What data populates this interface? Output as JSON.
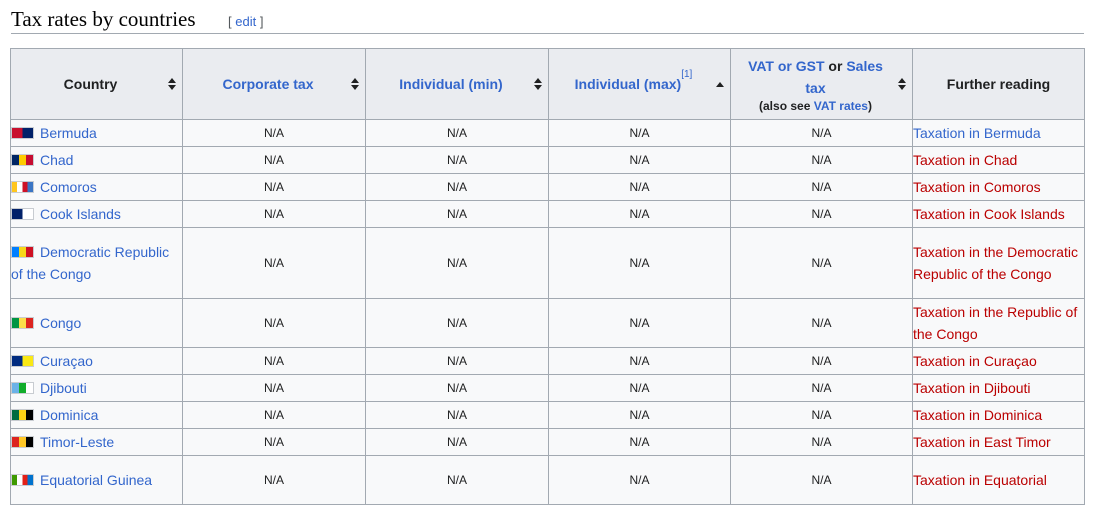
{
  "section": {
    "title": "Tax rates by countries",
    "edit_open": "[ ",
    "edit_label": "edit",
    "edit_close": " ]"
  },
  "table": {
    "headers": {
      "country": "Country",
      "corporate": "Corporate tax",
      "individual_min": "Individual (min)",
      "individual_max": "Individual (max)",
      "individual_max_ref": "[1]",
      "vat_part1": "VAT or GST",
      "vat_or": " or ",
      "vat_part2": "Sales",
      "vat_part3": "tax",
      "vat_note_prefix": "(also see ",
      "vat_note_link": "VAT rates",
      "vat_note_suffix": ")",
      "further": "Further reading"
    },
    "rows": [
      {
        "country": "Bermuda",
        "flag_colors": [
          "#c8102e",
          "#012169"
        ],
        "corporate": "N/A",
        "individual_min": "N/A",
        "individual_max": "N/A",
        "vat": "N/A",
        "further": "Taxation in Bermuda",
        "further_exists": true
      },
      {
        "country": "Chad",
        "flag_colors": [
          "#002664",
          "#fecb00",
          "#c60c30"
        ],
        "corporate": "N/A",
        "individual_min": "N/A",
        "individual_max": "N/A",
        "vat": "N/A",
        "further": "Taxation in Chad",
        "further_exists": false
      },
      {
        "country": "Comoros",
        "flag_colors": [
          "#ffc61e",
          "#ffffff",
          "#ce1126",
          "#3a75c4"
        ],
        "corporate": "N/A",
        "individual_min": "N/A",
        "individual_max": "N/A",
        "vat": "N/A",
        "further": "Taxation in Comoros",
        "further_exists": false
      },
      {
        "country": "Cook Islands",
        "flag_colors": [
          "#012169",
          "#ffffff"
        ],
        "corporate": "N/A",
        "individual_min": "N/A",
        "individual_max": "N/A",
        "vat": "N/A",
        "further": "Taxation in Cook Islands",
        "further_exists": false
      },
      {
        "country": "Democratic Republic of the Congo",
        "flag_colors": [
          "#007fff",
          "#f7d618",
          "#ce1021"
        ],
        "corporate": "N/A",
        "individual_min": "N/A",
        "individual_max": "N/A",
        "vat": "N/A",
        "further": "Taxation in the Democratic Republic of the Congo",
        "further_exists": false
      },
      {
        "country": "Congo",
        "flag_colors": [
          "#009543",
          "#fbde4a",
          "#dc241f"
        ],
        "corporate": "N/A",
        "individual_min": "N/A",
        "individual_max": "N/A",
        "vat": "N/A",
        "further": "Taxation in the Republic of the Congo",
        "further_exists": false
      },
      {
        "country": "Curaçao",
        "flag_colors": [
          "#002b7f",
          "#f9e814"
        ],
        "corporate": "N/A",
        "individual_min": "N/A",
        "individual_max": "N/A",
        "vat": "N/A",
        "further": "Taxation in Curaçao",
        "further_exists": false
      },
      {
        "country": "Djibouti",
        "flag_colors": [
          "#6ab2e7",
          "#12ad2b",
          "#ffffff"
        ],
        "corporate": "N/A",
        "individual_min": "N/A",
        "individual_max": "N/A",
        "vat": "N/A",
        "further": "Taxation in Djibouti",
        "further_exists": false
      },
      {
        "country": "Dominica",
        "flag_colors": [
          "#006b3f",
          "#fcd116",
          "#000000"
        ],
        "corporate": "N/A",
        "individual_min": "N/A",
        "individual_max": "N/A",
        "vat": "N/A",
        "further": "Taxation in Dominica",
        "further_exists": false
      },
      {
        "country": "Timor-Leste",
        "flag_colors": [
          "#dc241f",
          "#ffc726",
          "#000000"
        ],
        "corporate": "N/A",
        "individual_min": "N/A",
        "individual_max": "N/A",
        "vat": "N/A",
        "further": "Taxation in East Timor",
        "further_exists": false
      },
      {
        "country": "Equatorial Guinea",
        "flag_colors": [
          "#3e9a00",
          "#ffffff",
          "#e32118",
          "#0073ce"
        ],
        "corporate": "N/A",
        "individual_min": "N/A",
        "individual_max": "N/A",
        "vat": "N/A",
        "further": "Taxation in Equatorial",
        "further_exists": false
      }
    ]
  }
}
